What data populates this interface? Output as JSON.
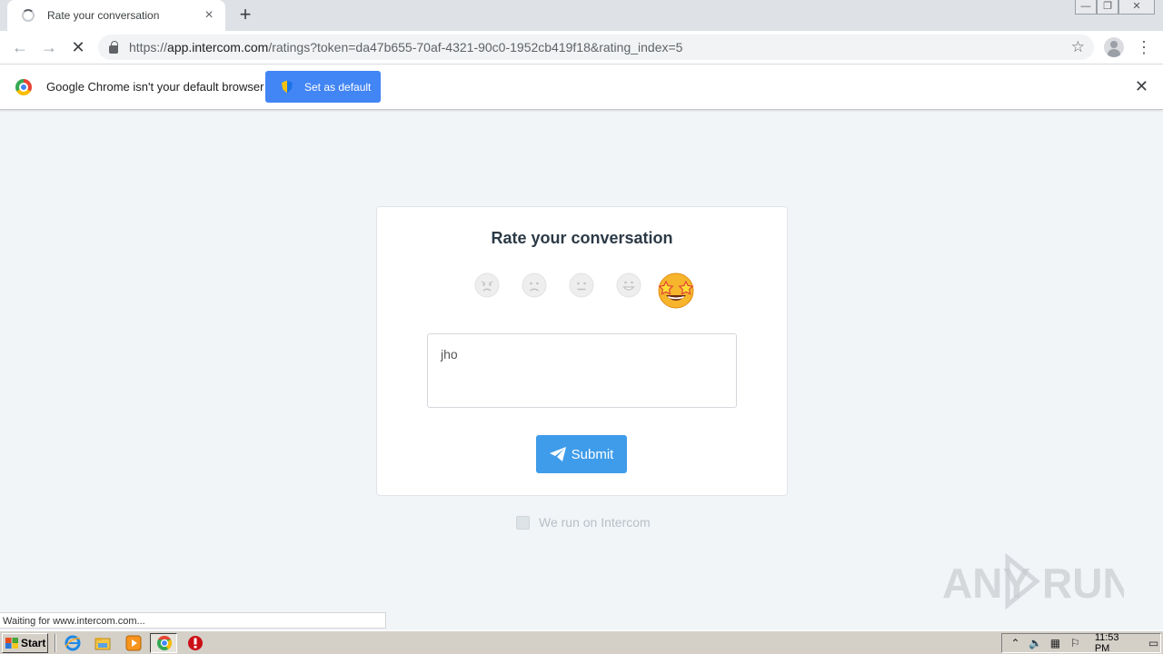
{
  "browser": {
    "tab": {
      "title": "Rate your conversation",
      "close_icon": "×"
    },
    "new_tab_icon": "+",
    "window_controls": {
      "minimize": "—",
      "restore": "❐",
      "close": "✕"
    },
    "nav": {
      "back": "←",
      "forward": "→",
      "reload": "✕"
    },
    "address": {
      "scheme": "https://",
      "host": "app.intercom.com",
      "path": "/ratings?token=da47b655-70af-4321-90c0-1952cb419f18&rating_index=5"
    },
    "bookmark_icon": "☆",
    "menu_icon": "⋮"
  },
  "infobar": {
    "message": "Google Chrome isn't your default browser",
    "button_label": "Set as default",
    "close_icon": "✕"
  },
  "rating": {
    "title": "Rate your conversation",
    "emojis": [
      {
        "name": "angry",
        "selected": false
      },
      {
        "name": "sad",
        "selected": false
      },
      {
        "name": "neutral",
        "selected": false
      },
      {
        "name": "smile",
        "selected": false
      },
      {
        "name": "star-struck",
        "selected": true
      }
    ],
    "feedback_value": "jho",
    "submit_label": "Submit"
  },
  "powered_by": "We run on Intercom",
  "status_text": "Waiting for www.intercom.com...",
  "watermark": "ANY RUN",
  "taskbar": {
    "start_label": "Start",
    "clock": "11:53 PM"
  },
  "colors": {
    "accent": "#3e9cea",
    "infobar_button": "#4285f4",
    "page_bg": "#f2f5f8"
  }
}
